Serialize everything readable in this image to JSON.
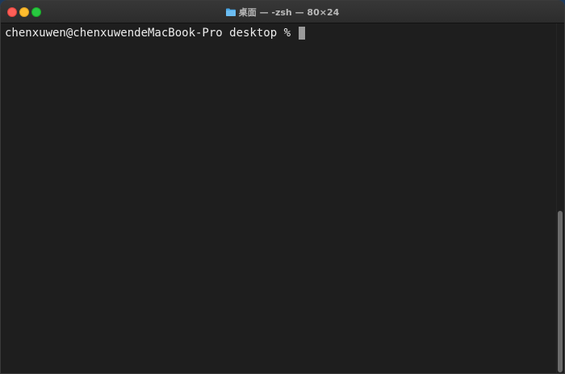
{
  "window": {
    "title": "桌面 — -zsh — 80×24",
    "title_icon": "folder-icon"
  },
  "terminal": {
    "prompt": "chenxuwen@chenxuwendeMacBook-Pro desktop % "
  },
  "colors": {
    "background": "#1e1e1e",
    "text": "#ececec",
    "cursor": "#9a9a9a",
    "folder": "#4aa8e8"
  }
}
